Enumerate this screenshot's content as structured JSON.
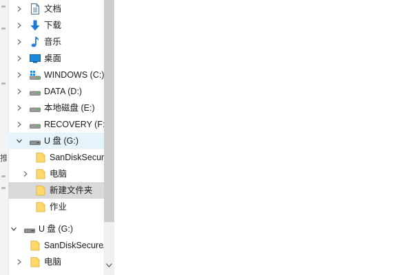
{
  "left_edge": {
    "partial_label": "推"
  },
  "nav_tree": [
    {
      "label": "文档",
      "icon": "documents-icon"
    },
    {
      "label": "下载",
      "icon": "downloads-icon"
    },
    {
      "label": "音乐",
      "icon": "music-icon"
    },
    {
      "label": "桌面",
      "icon": "desktop-icon"
    },
    {
      "label": "WINDOWS (C:)",
      "icon": "windows-drive-icon"
    },
    {
      "label": "DATA (D:)",
      "icon": "drive-icon"
    },
    {
      "label": "本地磁盘 (E:)",
      "icon": "drive-icon"
    },
    {
      "label": "RECOVERY (F:)",
      "icon": "drive-icon"
    },
    {
      "label": "U 盘 (G:)",
      "icon": "usb-drive-icon",
      "expanded": true,
      "hovered": true
    },
    {
      "label": "SanDiskSecureAccess",
      "icon": "folder-icon"
    },
    {
      "label": "电脑",
      "icon": "folder-icon"
    },
    {
      "label": "新建文件夹",
      "icon": "folder-icon",
      "selected": true
    },
    {
      "label": "作业",
      "icon": "folder-icon"
    },
    {
      "label": "U 盘 (G:)",
      "icon": "usb-drive-icon",
      "expanded": true
    },
    {
      "label": "SanDiskSecureAccess",
      "icon": "folder-icon"
    },
    {
      "label": "电脑",
      "icon": "folder-icon"
    }
  ],
  "colors": {
    "hover_bg": "#e5f3fb",
    "selected_bg": "#d9d9d9",
    "folder_yellow": "#ffd86b",
    "download_blue": "#1e78d7",
    "music_blue": "#2a7de1",
    "desktop_blue": "#1a8ad8"
  }
}
